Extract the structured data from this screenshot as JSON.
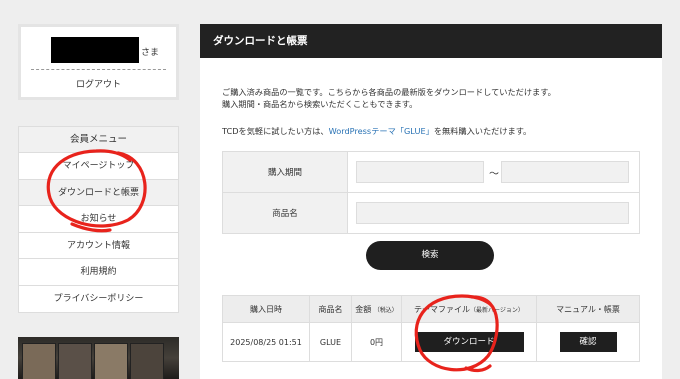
{
  "user": {
    "suffix": "さま",
    "logout": "ログアウト"
  },
  "menu": {
    "title": "会員メニュー",
    "items": [
      {
        "label": "マイページトップ"
      },
      {
        "label": "ダウンロードと帳票"
      },
      {
        "label": "お知らせ"
      },
      {
        "label": "アカウント情報"
      },
      {
        "label": "利用規約"
      },
      {
        "label": "プライバシーポリシー"
      }
    ]
  },
  "main": {
    "title": "ダウンロードと帳票",
    "desc_line1": "ご購入済み商品の一覧です。こちらから各商品の最新版をダウンロードしていただけます。",
    "desc_line2": "購入期間・商品名から検索いただくこともできます。",
    "note_prefix": "TCDを気軽に試したい方は、",
    "note_link": "WordPressテーマ「GLUE」",
    "note_suffix": "を無料購入いただけます。"
  },
  "search": {
    "period_label": "購入期間",
    "product_label": "商品名",
    "tilde": "〜",
    "button": "検索"
  },
  "orders": {
    "headers": [
      "購入日時",
      "商品名",
      "金額",
      "テーマファイル",
      "マニュアル・帳票"
    ],
    "amount_sub": "（税込）",
    "file_sub": "（最新バージョン）",
    "rows": [
      {
        "date": "2025/08/25 01:51",
        "product": "GLUE",
        "amount": "0円",
        "download": "ダウンロード",
        "confirm": "確認"
      }
    ]
  },
  "colors": {
    "header_bg": "#222222",
    "link": "#2a73b5",
    "annotation": "#e8231c"
  }
}
